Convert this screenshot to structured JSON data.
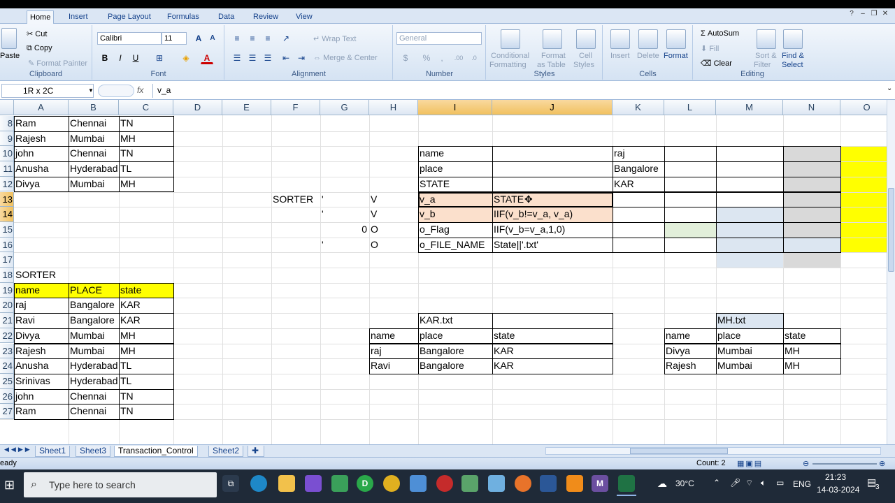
{
  "ribbon": {
    "tabs": [
      "Home",
      "Insert",
      "Page Layout",
      "Formulas",
      "Data",
      "Review",
      "View"
    ],
    "clipboard": {
      "paste": "Paste",
      "cut": "Cut",
      "copy": "Copy",
      "format_painter": "Format Painter",
      "label": "Clipboard"
    },
    "font": {
      "name": "Calibri",
      "size": "11",
      "bold": "B",
      "italic": "I",
      "underline": "U",
      "label": "Font"
    },
    "alignment": {
      "wrap": "Wrap Text",
      "merge": "Merge & Center",
      "label": "Alignment"
    },
    "number": {
      "format": "General",
      "percent": "%",
      "comma": ",",
      "label": "Number"
    },
    "styles": {
      "conditional": "Conditional",
      "formatting": "Formatting",
      "format": "Format",
      "as_table": "as Table",
      "cell": "Cell",
      "cell_styles": "Styles",
      "label": "Styles"
    },
    "cells": {
      "insert": "Insert",
      "delete": "Delete",
      "format": "Format",
      "label": "Cells"
    },
    "editing": {
      "autosum": "AutoSum",
      "fill": "Fill",
      "clear": "Clear",
      "sort": "Sort &",
      "filter": "Filter",
      "find": "Find &",
      "select": "Select",
      "label": "Editing"
    }
  },
  "formula_bar": {
    "name_box": "1R x 2C",
    "fx": "fx",
    "value": "v_a"
  },
  "columns": [
    "A",
    "B",
    "C",
    "D",
    "E",
    "F",
    "G",
    "H",
    "I",
    "J",
    "K",
    "L",
    "M",
    "N",
    "O"
  ],
  "rows": [
    "8",
    "9",
    "10",
    "11",
    "12",
    "13",
    "14",
    "15",
    "16",
    "17",
    "18",
    "19",
    "20",
    "21",
    "22",
    "23",
    "24",
    "25",
    "26",
    "27"
  ],
  "cells": {
    "A8": "Ram",
    "B8": "Chennai",
    "C8": "TN",
    "A9": "Rajesh",
    "B9": "Mumbai",
    "C9": "MH",
    "A10": "john",
    "B10": "Chennai",
    "C10": "TN",
    "A11": "Anusha",
    "B11": "Hyderabad",
    "C11": "TL",
    "A12": "Divya",
    "B12": "Mumbai",
    "C12": "MH",
    "I10": "name",
    "K10": "raj",
    "I11": "place",
    "K11": "Bangalore",
    "I12": "STATE",
    "K12": "KAR",
    "F13": "SORTER",
    "G13": "'",
    "H13": "V",
    "I13": "v_a",
    "J13": "STATE",
    "G14": "'",
    "H14": "V",
    "I14": "v_b",
    "J14": "IIF(v_b!=v_a,  v_a)",
    "G15": "0",
    "H15": "O",
    "I15": "o_Flag",
    "J15": "IIF(v_b=v_a,1,0)",
    "G16": "'",
    "H16": "O",
    "I16": "o_FILE_NAME",
    "J16": "State||'.txt'",
    "A18": "SORTER",
    "A19": "name",
    "B19": "PLACE",
    "C19": "state",
    "A20": "raj",
    "B20": "Bangalore",
    "C20": "KAR",
    "A21": "Ravi",
    "B21": "Bangalore",
    "C21": "KAR",
    "A22": "Divya",
    "B22": "Mumbai",
    "C22": "MH",
    "A23": "Rajesh",
    "B23": "Mumbai",
    "C23": "MH",
    "A24": "Anusha",
    "B24": "Hyderabad",
    "C24": "TL",
    "A25": "Srinivas",
    "B25": "Hyderabad",
    "C25": "TL",
    "A26": "john",
    "B26": "Chennai",
    "C26": "TN",
    "A27": "Ram",
    "B27": "Chennai",
    "C27": "TN",
    "I21": "KAR.txt",
    "M21": "MH.txt",
    "H22": "name",
    "I22": "place",
    "J22": "state",
    "L22": "name",
    "M22": "place",
    "N22": "state",
    "H23": "raj",
    "I23": "Bangalore",
    "J23": "KAR",
    "L23": "Divya",
    "M23": "Mumbai",
    "N23": "MH",
    "H24": "Ravi",
    "I24": "Bangalore",
    "J24": "KAR",
    "L24": "Rajesh",
    "M24": "Mumbai",
    "N24": "MH"
  },
  "sheets": [
    "Sheet1",
    "Sheet3",
    "Transaction_Control",
    "Sheet2"
  ],
  "active_sheet": "Transaction_Control",
  "status": {
    "mode": "eady",
    "count": "Count: 2"
  },
  "taskbar": {
    "search_placeholder": "Type here to search",
    "weather": "30°C",
    "lang": "ENG",
    "time": "21:23",
    "date": "14-03-2024",
    "notif": "3"
  },
  "colors": {
    "yellow": "#ffff00",
    "peach": "#fbe0cc",
    "light_blue": "#dce6f1",
    "light_green": "#e2efda",
    "gray": "#d9d9d9",
    "accent": "#15428b"
  }
}
